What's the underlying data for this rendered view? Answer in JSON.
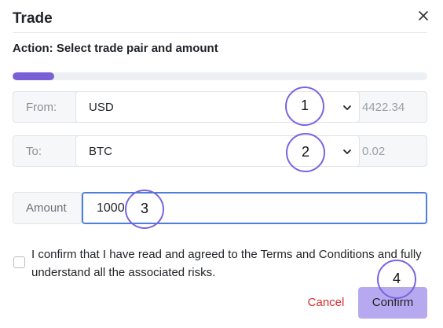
{
  "dialog": {
    "title": "Trade",
    "close_icon": "close-icon",
    "action": "Action: Select trade pair and amount",
    "progress": 0.1
  },
  "from_row": {
    "label": "From:",
    "value": "USD",
    "rate": "4422.34"
  },
  "to_row": {
    "label": "To:",
    "value": "BTC",
    "rate": "0.02"
  },
  "amount": {
    "label": "Amount",
    "value": "1000"
  },
  "terms": {
    "text": "I confirm that I have read and agreed to the Terms and Conditions and fully understand all the associated risks."
  },
  "buttons": {
    "cancel": "Cancel",
    "confirm": "Confirm"
  },
  "markers": [
    "1",
    "2",
    "3",
    "4"
  ],
  "colors": {
    "accent": "#7b5fd6",
    "confirm_bg": "#b7a9f0",
    "cancel_text": "#d32f2f",
    "input_focus": "#4c7fd9"
  }
}
